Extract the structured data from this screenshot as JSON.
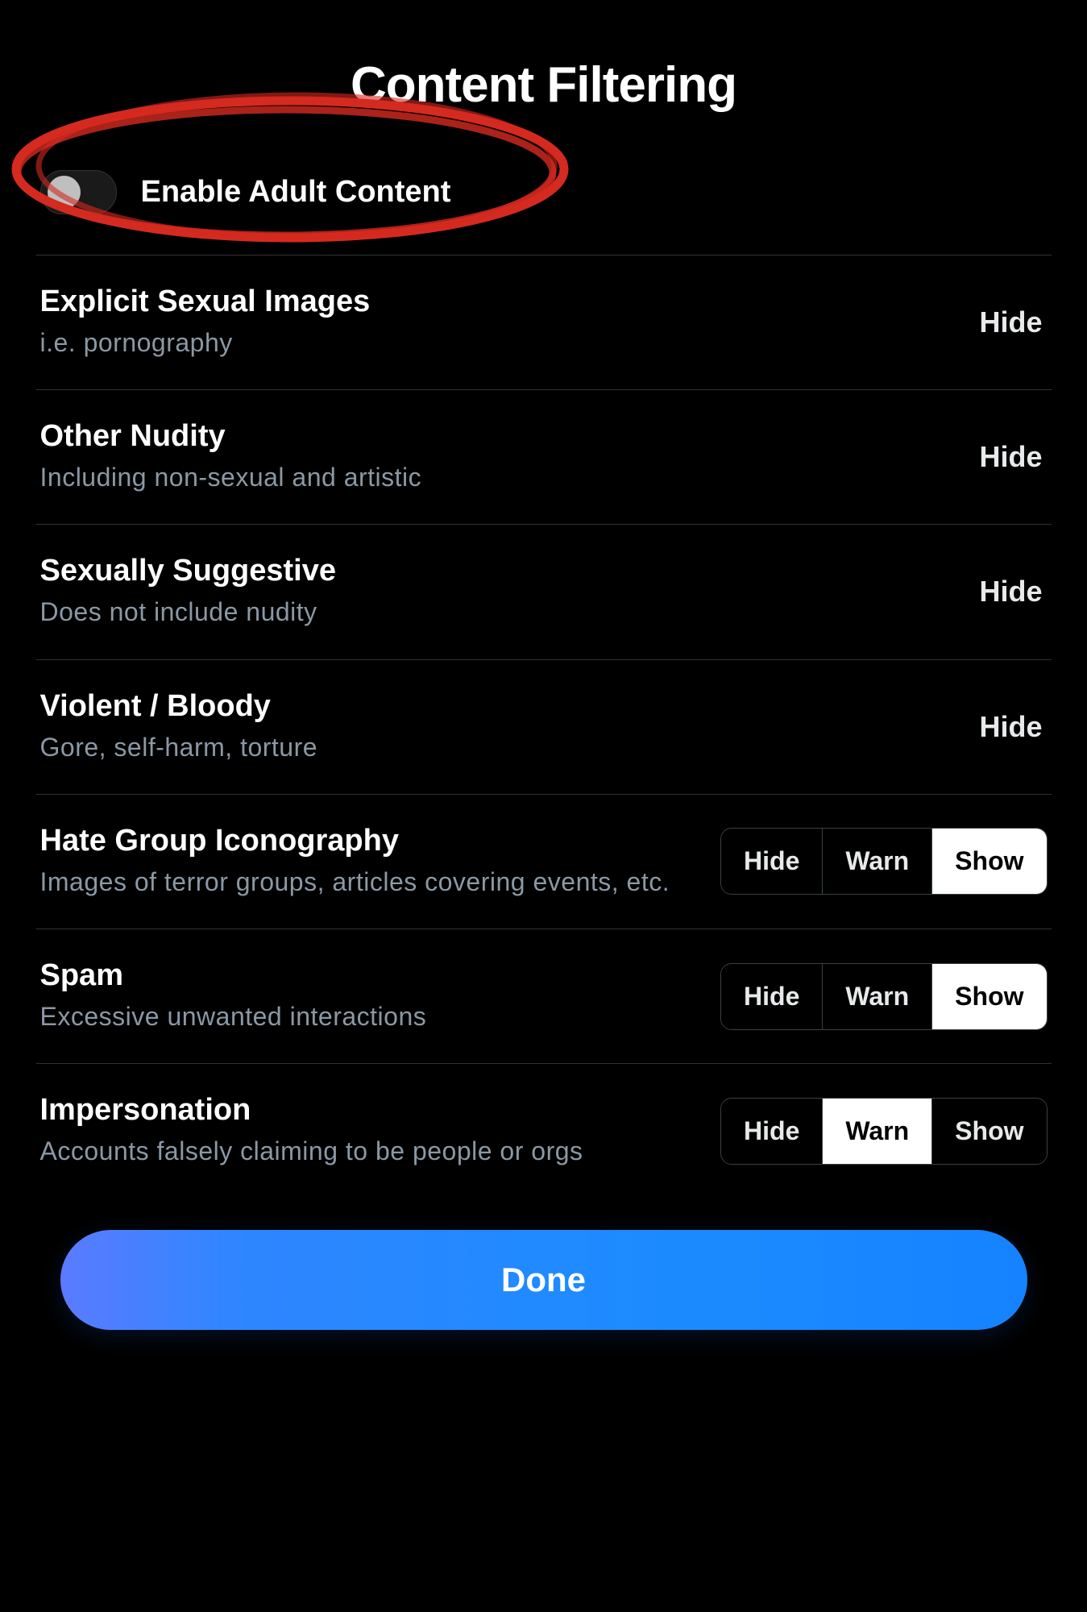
{
  "title": "Content Filtering",
  "toggle": {
    "label": "Enable Adult Content",
    "enabled": false
  },
  "seg_labels": {
    "hide": "Hide",
    "warn": "Warn",
    "show": "Show"
  },
  "rows": [
    {
      "title": "Explicit Sexual Images",
      "sub": "i.e. pornography",
      "value": "Hide",
      "type": "locked"
    },
    {
      "title": "Other Nudity",
      "sub": "Including non-sexual and artistic",
      "value": "Hide",
      "type": "locked"
    },
    {
      "title": "Sexually Suggestive",
      "sub": "Does not include nudity",
      "value": "Hide",
      "type": "locked"
    },
    {
      "title": "Violent / Bloody",
      "sub": "Gore, self-harm, torture",
      "value": "Hide",
      "type": "locked"
    },
    {
      "title": "Hate Group Iconography",
      "sub": "Images of terror groups, articles covering events, etc.",
      "value": "Show",
      "type": "seg"
    },
    {
      "title": "Spam",
      "sub": "Excessive unwanted interactions",
      "value": "Show",
      "type": "seg"
    },
    {
      "title": "Impersonation",
      "sub": "Accounts falsely claiming to be people or orgs",
      "value": "Warn",
      "type": "seg"
    }
  ],
  "done_label": "Done"
}
